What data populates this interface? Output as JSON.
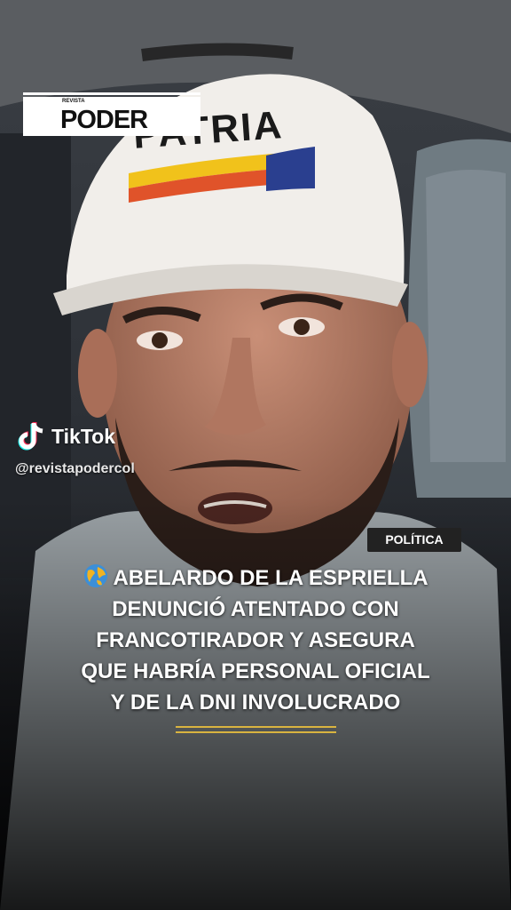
{
  "brand": {
    "logo_small": "REVISTA",
    "logo_text": "PODER"
  },
  "cap_text": "PATRIA",
  "tiktok": {
    "name": "TikTok",
    "handle": "@revistapodercol"
  },
  "category": "POLÍTICA",
  "headline_lines": [
    "ABELARDO DE LA ESPRIELLA",
    "DENUNCIÓ ATENTADO CON",
    "FRANCOTIRADOR Y ASEGURA",
    "QUE HABRÍA PERSONAL OFICIAL",
    "Y DE LA DNI INVOLUCRADO"
  ],
  "colors": {
    "accent_gold": "#d9b440",
    "tag_bg": "#222222",
    "text": "#ffffff"
  }
}
